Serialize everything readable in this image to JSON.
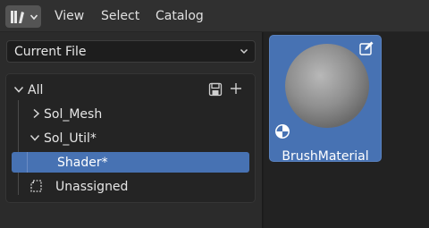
{
  "header": {
    "menu": [
      "View",
      "Select",
      "Catalog"
    ]
  },
  "library_dropdown": {
    "value": "Current File"
  },
  "tree": {
    "root_label": "All",
    "items": [
      {
        "label": "Sol_Mesh",
        "expanded": false
      },
      {
        "label": "Sol_Util*",
        "expanded": true
      },
      {
        "label": "Shader*",
        "selected": true
      },
      {
        "label": "Unassigned"
      }
    ]
  },
  "asset": {
    "name": "BrushMaterial"
  },
  "colors": {
    "selection": "#4772b3",
    "header": "#303030",
    "panel": "#2b2b2b"
  }
}
